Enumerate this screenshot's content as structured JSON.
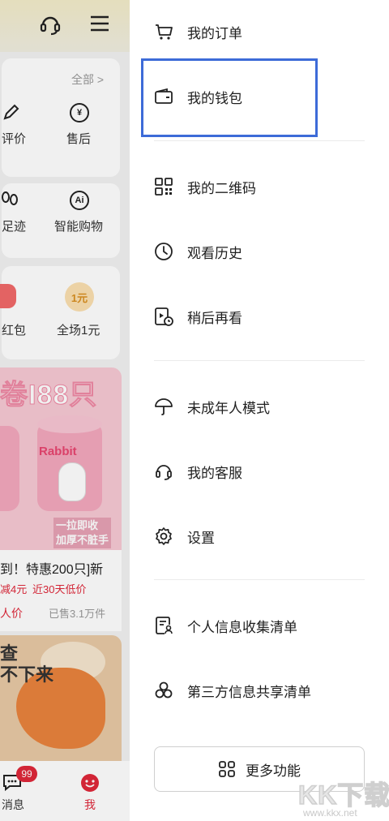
{
  "background": {
    "all_link": "全部 >",
    "row1": [
      "评价",
      "售后"
    ],
    "row2": [
      "足迹",
      "智能购物"
    ],
    "row3": [
      "红包",
      "全场1元"
    ],
    "coin_symbol": "¥",
    "ai_symbol": "Ai",
    "one_yuan_symbol": "1元",
    "promo_title": "卷I88只",
    "promo_can_label": "Rabbit",
    "promo_tag": "一拉即收\n加厚不脏手",
    "product_title": "到！特惠200只]新",
    "product_discount": "减4元",
    "product_lowprice": "近30天低价",
    "product_people": "人价",
    "product_sold": "已售3.1万件",
    "food_text": "查\n不下来",
    "tabs": [
      {
        "label": "消息",
        "badge": "99"
      },
      {
        "label": "我"
      }
    ],
    "accent_color": "#e0283a"
  },
  "drawer": {
    "group1": [
      {
        "label": "我的订单",
        "icon": "cart-icon"
      },
      {
        "label": "我的钱包",
        "icon": "wallet-icon",
        "highlighted": true
      }
    ],
    "group2": [
      {
        "label": "我的二维码",
        "icon": "qr-code-icon"
      },
      {
        "label": "观看历史",
        "icon": "clock-icon"
      },
      {
        "label": "稍后再看",
        "icon": "watch-later-icon"
      }
    ],
    "group3": [
      {
        "label": "未成年人模式",
        "icon": "umbrella-icon"
      },
      {
        "label": "我的客服",
        "icon": "headset-icon"
      },
      {
        "label": "设置",
        "icon": "gear-icon"
      }
    ],
    "group4": [
      {
        "label": "个人信息收集清单",
        "icon": "personal-info-icon"
      },
      {
        "label": "第三方信息共享清单",
        "icon": "share-list-icon"
      }
    ],
    "more_button": "更多功能",
    "highlight_color": "#3d6bd8"
  },
  "watermark": {
    "big": "KK下载",
    "small": "www.kkx.net"
  }
}
